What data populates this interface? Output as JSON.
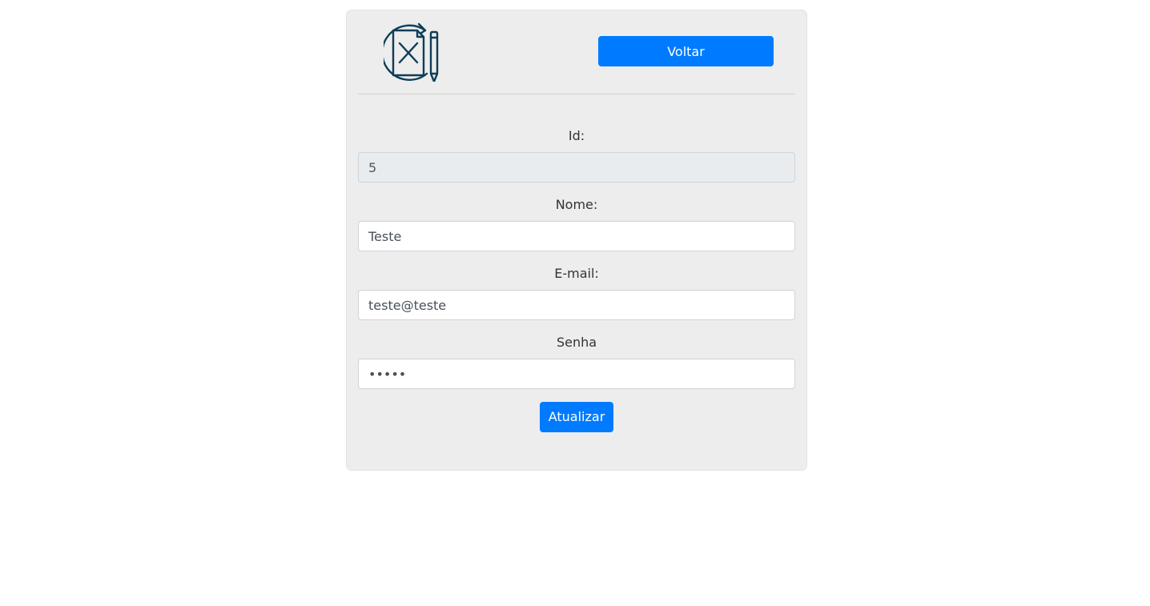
{
  "header": {
    "logo_icon": "document-edit-icon",
    "back_label": "Voltar"
  },
  "form": {
    "id": {
      "label": "Id:",
      "value": "5"
    },
    "nome": {
      "label": "Nome:",
      "value": "Teste"
    },
    "email": {
      "label": "E-mail:",
      "value": "teste@teste"
    },
    "senha": {
      "label": "Senha",
      "value": "•••••"
    },
    "submit_label": "Atualizar"
  },
  "colors": {
    "primary": "#007bff",
    "card_background": "#ededed",
    "icon": "#0e3d57"
  }
}
